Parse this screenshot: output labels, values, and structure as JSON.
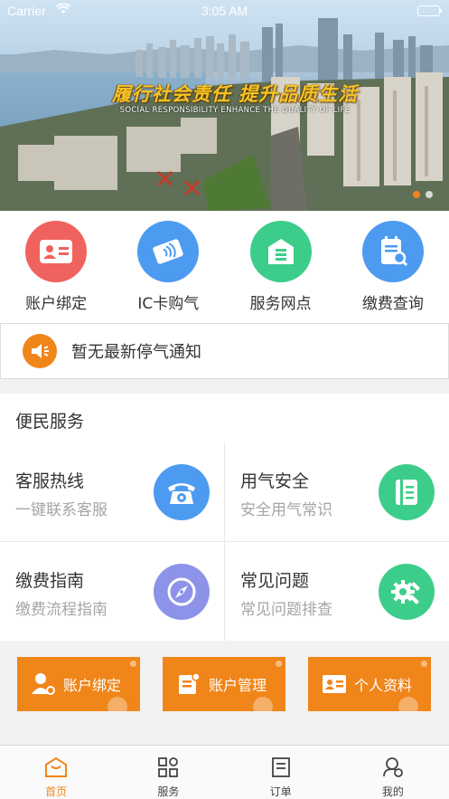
{
  "status_bar": {
    "carrier": "Carrier",
    "time": "3:05 AM"
  },
  "banner": {
    "slogan_cn": "履行社会责任  提升品质生活",
    "slogan_en": "SOCIAL RESPONSIBILITY ENHANCE THE QUALITY OF LIFE",
    "slide_count": 2,
    "active_slide": 1
  },
  "quick_menu": [
    {
      "label": "账户绑定",
      "icon": "id-card-icon",
      "color": "#f0625d"
    },
    {
      "label": "IC卡购气",
      "icon": "nfc-card-icon",
      "color": "#4d9bf0"
    },
    {
      "label": "服务网点",
      "icon": "store-icon",
      "color": "#3dcd8a"
    },
    {
      "label": "缴费查询",
      "icon": "bill-search-icon",
      "color": "#4d9bf0"
    }
  ],
  "notice": {
    "text": "暂无最新停气通知",
    "icon": "speaker-icon"
  },
  "services": {
    "title": "便民服务",
    "items": [
      {
        "title": "客服热线",
        "sub": "一键联系客服",
        "icon": "telephone-icon",
        "color": "#4d9bf0"
      },
      {
        "title": "用气安全",
        "sub": "安全用气常识",
        "icon": "notebook-icon",
        "color": "#3dcd8a"
      },
      {
        "title": "缴费指南",
        "sub": "缴费流程指南",
        "icon": "compass-icon",
        "color": "#8d93e8"
      },
      {
        "title": "常见问题",
        "sub": "常见问题排查",
        "icon": "gear-wrench-icon",
        "color": "#3dcd8a"
      }
    ]
  },
  "actions": [
    {
      "label": "账户绑定",
      "icon": "user-bind-icon"
    },
    {
      "label": "账户管理",
      "icon": "account-manage-icon"
    },
    {
      "label": "个人资料",
      "icon": "profile-card-icon"
    }
  ],
  "tabbar": [
    {
      "label": "首页",
      "icon": "home-icon",
      "active": true
    },
    {
      "label": "服务",
      "icon": "grid-icon",
      "active": false
    },
    {
      "label": "订单",
      "icon": "order-icon",
      "active": false
    },
    {
      "label": "我的",
      "icon": "user-icon",
      "active": false
    }
  ],
  "accent_color": "#f08519"
}
